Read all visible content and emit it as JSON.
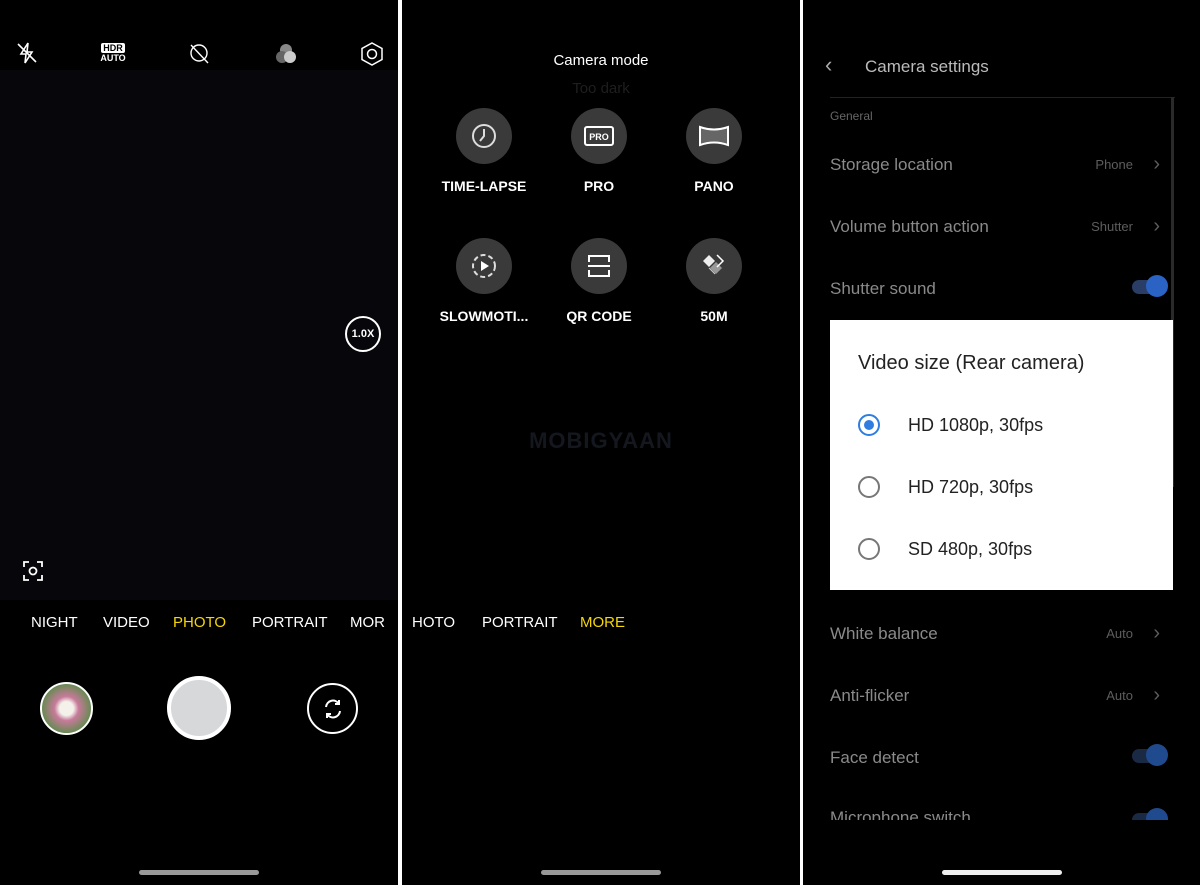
{
  "camera": {
    "top_icons": [
      "flash-off-icon",
      "hdr-auto-icon",
      "ai-off-icon",
      "filter-icon",
      "settings-icon"
    ],
    "hdr_label": "HDR",
    "hdr_sub": "AUTO",
    "zoom": "1.0X",
    "modes": [
      "NIGHT",
      "VIDEO",
      "PHOTO",
      "PORTRAIT",
      "MOR"
    ],
    "active_mode": "PHOTO",
    "accent": "#f5d60a"
  },
  "mode_panel": {
    "title": "Camera mode",
    "hint": "Too dark",
    "modes": [
      {
        "label": "TIME-LAPSE",
        "icon": "timelapse-icon"
      },
      {
        "label": "PRO",
        "icon": "pro-icon",
        "badge": "PRO"
      },
      {
        "label": "PANO",
        "icon": "panorama-icon"
      },
      {
        "label": "SLOWMOTI...",
        "icon": "slow-motion-icon"
      },
      {
        "label": "QR CODE",
        "icon": "qr-scan-icon"
      },
      {
        "label": "50M",
        "icon": "50m-icon"
      }
    ],
    "watermark": "MOBIGYAAN",
    "modebar": [
      "HOTO",
      "PORTRAIT",
      "MORE"
    ],
    "active_mode": "MORE"
  },
  "settings": {
    "title": "Camera settings",
    "section": "General",
    "rows": [
      {
        "label": "Storage location",
        "value": "Phone"
      },
      {
        "label": "Volume button action",
        "value": "Shutter"
      },
      {
        "label": "Shutter sound",
        "toggle": true
      }
    ],
    "rows_below": [
      {
        "label": "White balance",
        "value": "Auto"
      },
      {
        "label": "Anti-flicker",
        "value": "Auto"
      },
      {
        "label": "Face detect",
        "toggle": true
      },
      {
        "label": "Microphone switch",
        "toggle": true
      }
    ],
    "dialog": {
      "title": "Video size (Rear camera)",
      "options": [
        "HD 1080p, 30fps",
        "HD 720p, 30fps",
        "SD 480p, 30fps"
      ],
      "selected": "HD 1080p, 30fps",
      "accent": "#2f7de1"
    }
  }
}
